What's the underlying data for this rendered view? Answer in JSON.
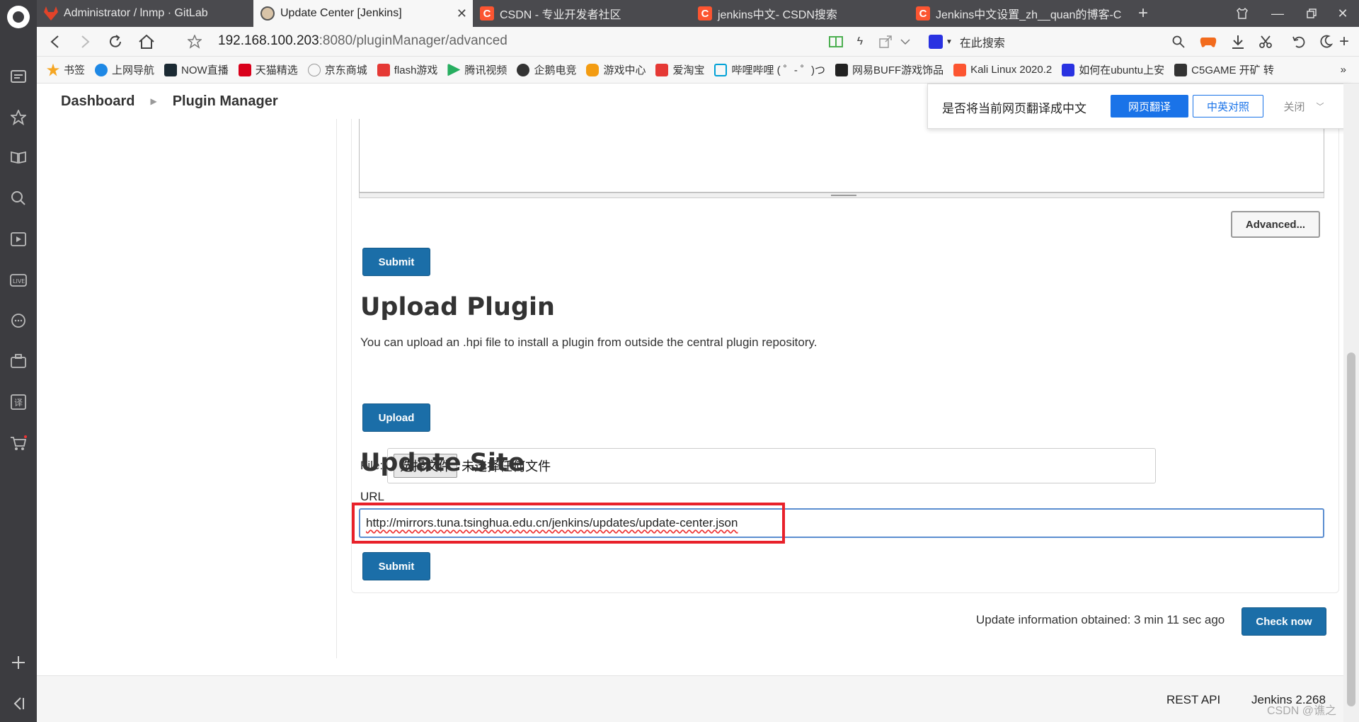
{
  "browser": {
    "tabs": [
      {
        "title": "Administrator / lnmp · GitLab",
        "icon": "gitlab-icon",
        "color": "#e24329"
      },
      {
        "title": "Update Center [Jenkins]",
        "icon": "jenkins-icon",
        "color": "#d24939"
      },
      {
        "title": "CSDN - 专业开发者社区",
        "icon": "csdn-icon",
        "color": "#fc5531"
      },
      {
        "title": "jenkins中文- CSDN搜索",
        "icon": "csdn-icon",
        "color": "#fc5531"
      },
      {
        "title": "Jenkins中文设置_zh__quan的博客-C",
        "icon": "csdn-icon",
        "color": "#fc5531"
      }
    ],
    "address": {
      "host": "192.168.100.203",
      "path": ":8080/pluginManager/advanced"
    },
    "search_placeholder": "在此搜索",
    "bookmarks": [
      {
        "label": "书签",
        "color": "#f5a623"
      },
      {
        "label": "上网导航",
        "color": "#1e88e5"
      },
      {
        "label": "NOW直播",
        "color": "#1b2a33"
      },
      {
        "label": "天猫精选",
        "color": "#d9001b"
      },
      {
        "label": "京东商城",
        "color": "#999999"
      },
      {
        "label": "flash游戏",
        "color": "#e53935"
      },
      {
        "label": "腾讯视频",
        "color": "#27ae60"
      },
      {
        "label": "企鹅电竞",
        "color": "#333333"
      },
      {
        "label": "游戏中心",
        "color": "#f39c12"
      },
      {
        "label": "爱淘宝",
        "color": "#e53935"
      },
      {
        "label": "哔哩哔哩 ( ゜- ゜)つ",
        "color": "#00a1d6"
      },
      {
        "label": "网易BUFF游戏饰品",
        "color": "#222222"
      },
      {
        "label": "Kali Linux 2020.2",
        "color": "#fc5531"
      },
      {
        "label": "如何在ubuntu上安",
        "color": "#2932e1"
      },
      {
        "label": "C5GAME 开矿 转",
        "color": "#333333"
      }
    ]
  },
  "jenkins": {
    "breadcrumb": [
      "Dashboard",
      "Plugin Manager"
    ],
    "advanced_button": "Advanced...",
    "submit_button": "Submit",
    "upload": {
      "title": "Upload Plugin",
      "description": "You can upload an .hpi file to install a plugin from outside the central plugin repository.",
      "file_label": "File:",
      "choose_button": "选择文件",
      "file_status": "未选择任何文件",
      "upload_button": "Upload"
    },
    "update_site": {
      "title": "Update Site",
      "url_label": "URL",
      "url_value": "http://mirrors.tuna.tsinghua.edu.cn/jenkins/updates/update-center.json",
      "submit_button": "Submit"
    },
    "update_info": "Update information obtained: 3 min 11 sec ago",
    "check_now": "Check now",
    "footer": {
      "rest_api": "REST API",
      "version": "Jenkins 2.268"
    }
  },
  "translate_popup": {
    "question": "是否将当前网页翻译成中文",
    "translate_button": "网页翻译",
    "bilingual_button": "中英对照",
    "close_button": "关闭"
  },
  "watermark": "CSDN @谯之"
}
